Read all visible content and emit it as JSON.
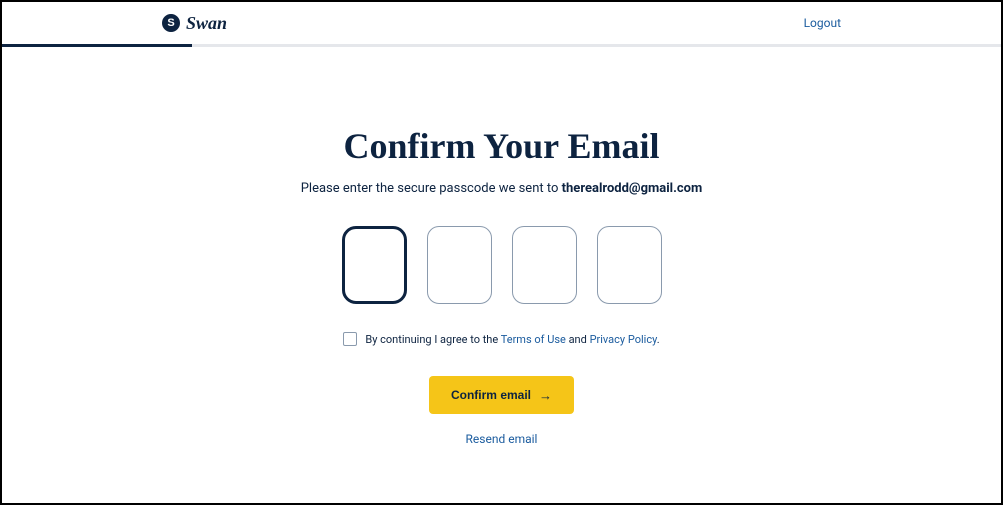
{
  "header": {
    "brand": "Swan",
    "logout_label": "Logout"
  },
  "progress": {
    "percent": 19
  },
  "main": {
    "title": "Confirm Your Email",
    "subtitle_prefix": "Please enter the secure passcode we sent to ",
    "subtitle_email": "therealrodd@gmail.com",
    "code_values": [
      "",
      "",
      "",
      ""
    ],
    "consent_prefix": "By continuing I agree to the ",
    "terms_label": "Terms of Use",
    "consent_and": " and ",
    "privacy_label": "Privacy Policy",
    "consent_suffix": ".",
    "confirm_label": "Confirm email",
    "resend_label": "Resend email"
  },
  "colors": {
    "primary_dark": "#0d2340",
    "accent_yellow": "#f5c518",
    "link_blue": "#1a5b9e",
    "border_gray": "#8a9aad"
  }
}
